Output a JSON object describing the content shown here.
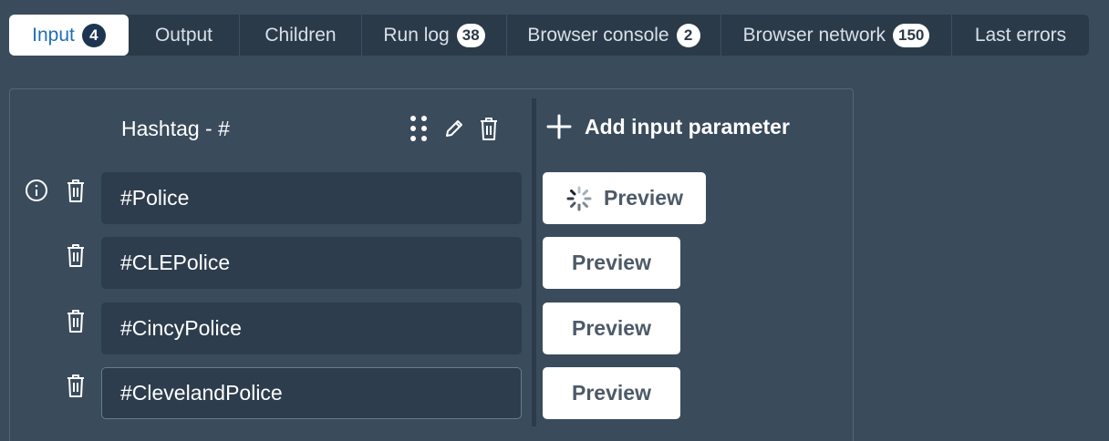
{
  "tabs": [
    {
      "label": "Input",
      "badge": "4"
    },
    {
      "label": "Output"
    },
    {
      "label": "Children"
    },
    {
      "label": "Run log",
      "badge": "38"
    },
    {
      "label": "Browser console",
      "badge": "2"
    },
    {
      "label": "Browser network",
      "badge": "150"
    },
    {
      "label": "Last errors"
    }
  ],
  "active_tab": "Input",
  "input_panel": {
    "column_header": "Hashtag - #",
    "add_parameter_label": "Add input parameter",
    "preview_label": "Preview",
    "rows": [
      {
        "value": "#Police",
        "loading": true
      },
      {
        "value": "#CLEPolice",
        "loading": false
      },
      {
        "value": "#CincyPolice",
        "loading": false
      },
      {
        "value": "#ClevelandPolice",
        "loading": false
      }
    ]
  },
  "colors": {
    "background": "#3a4b5c",
    "tab_bar": "#2b3a49",
    "active_tab_text": "#1f6fb8",
    "input_background": "#2d3d4d"
  }
}
